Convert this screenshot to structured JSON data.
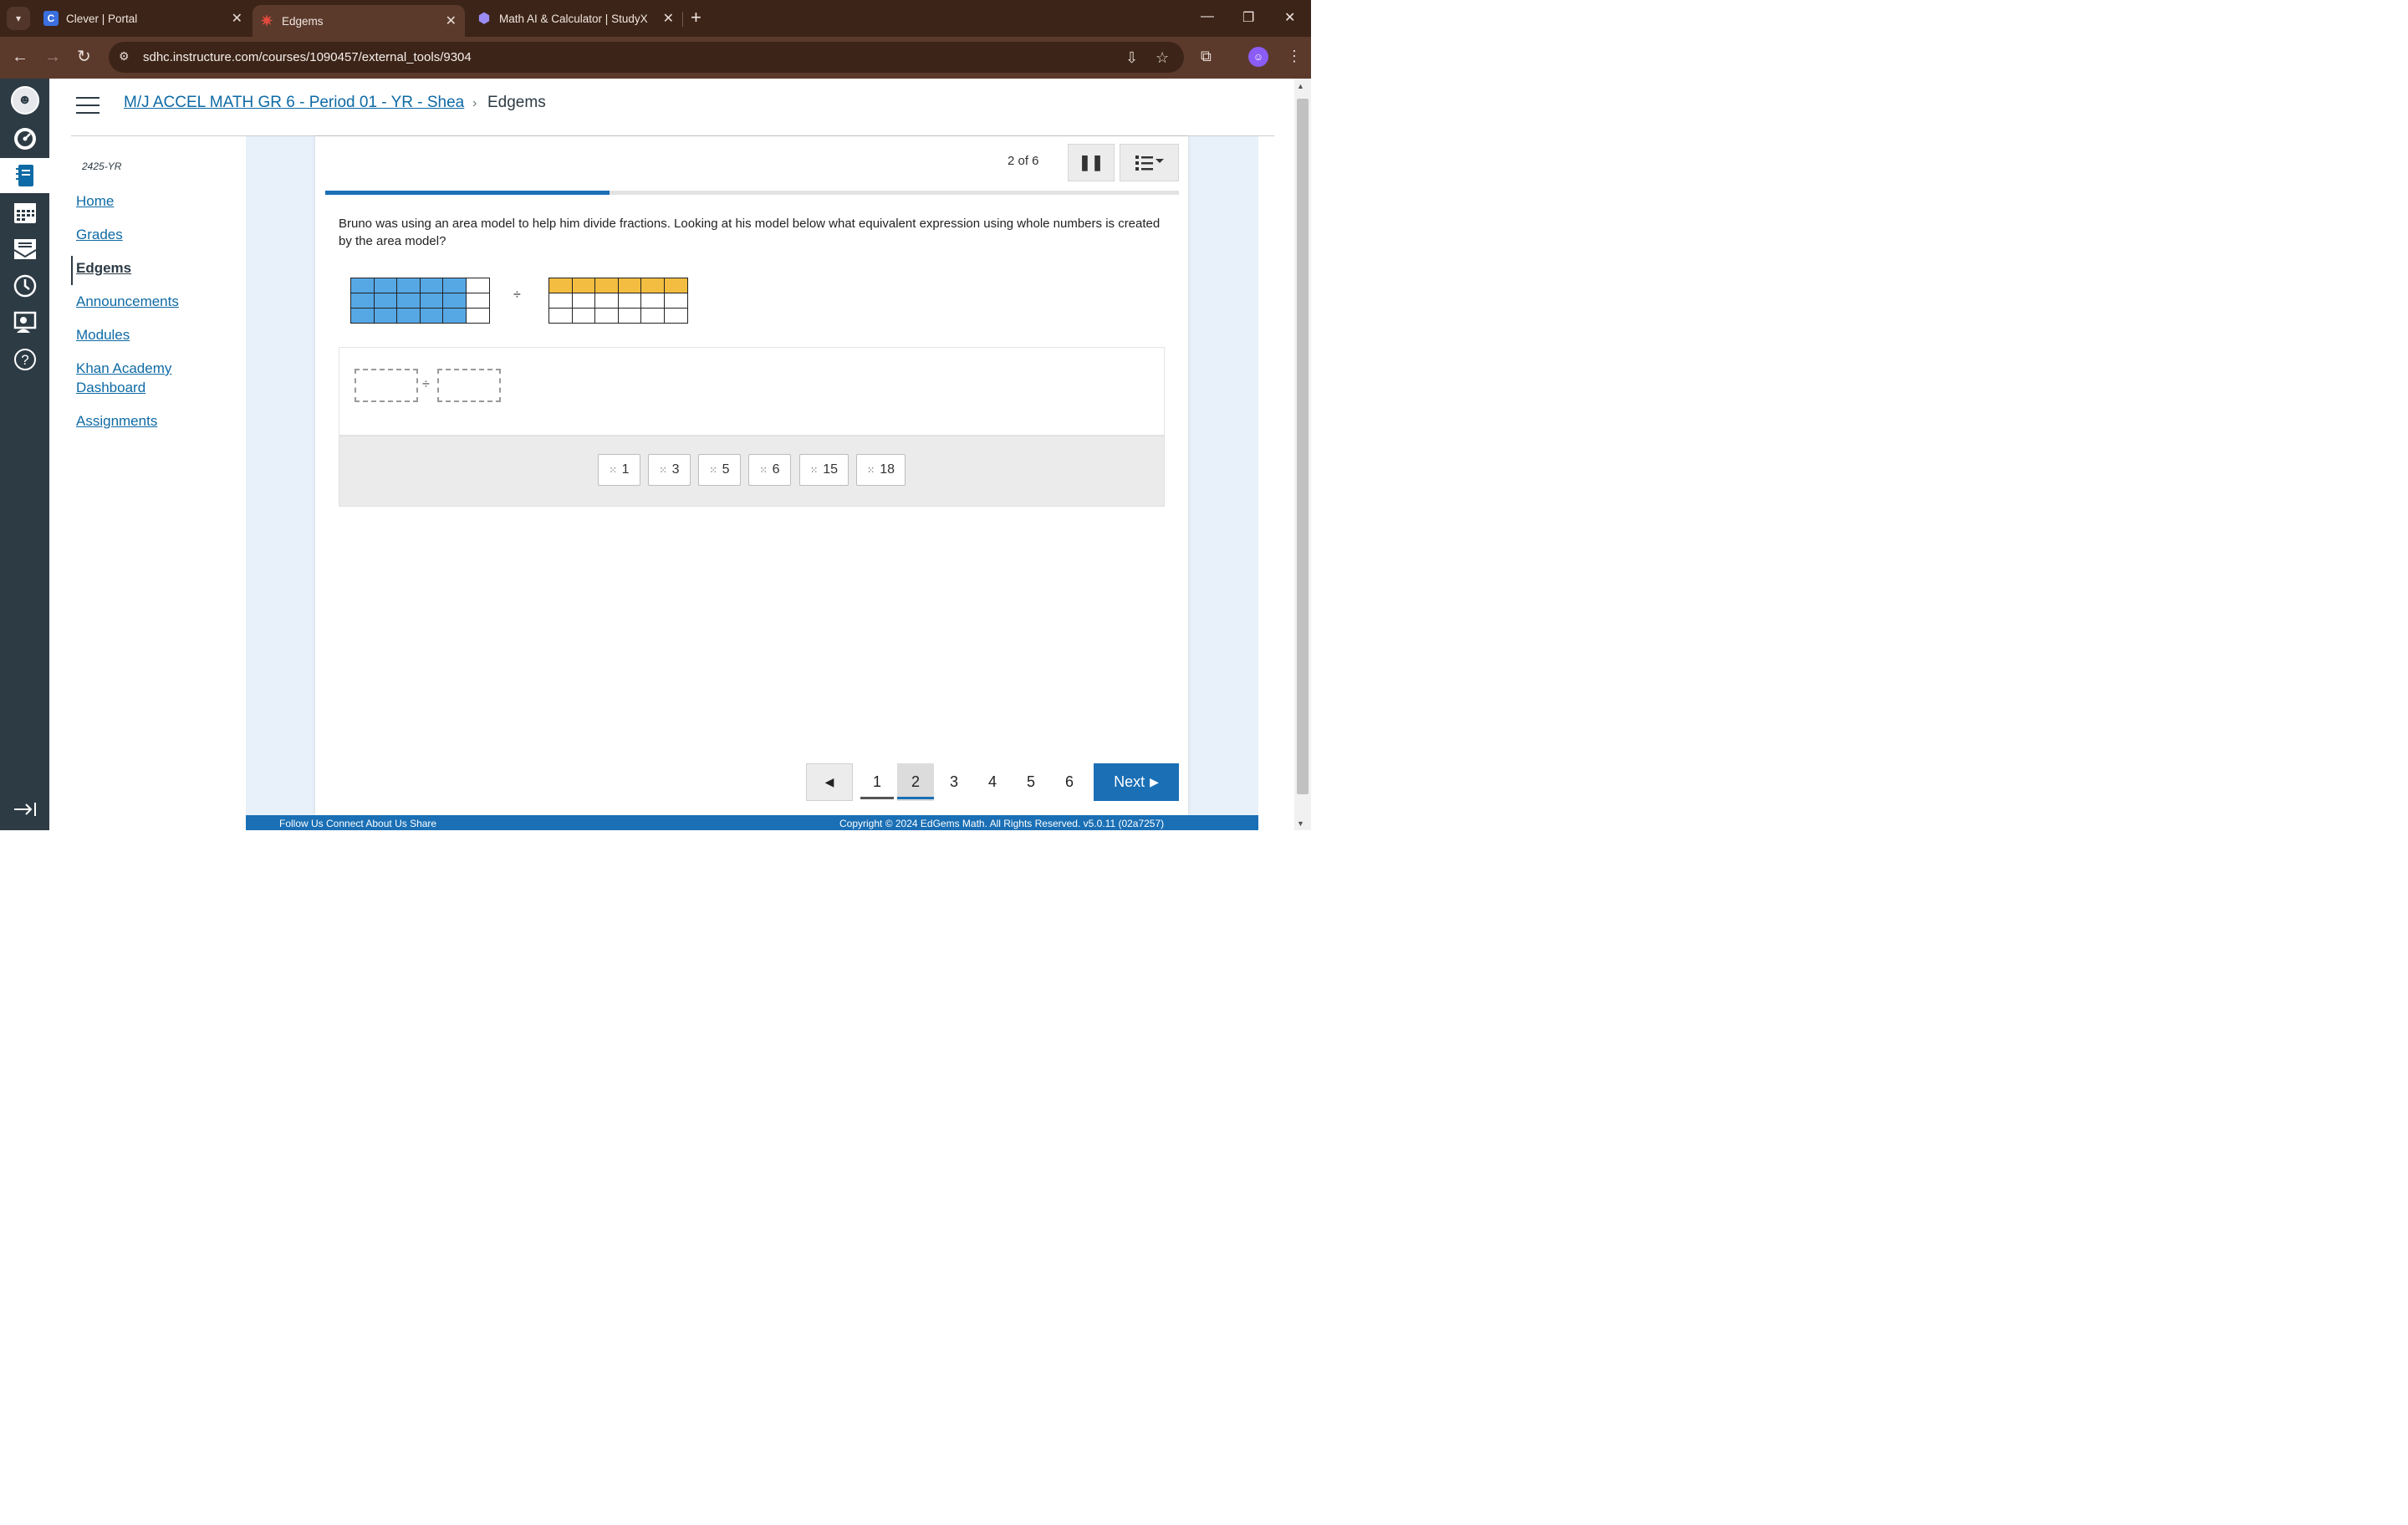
{
  "browser": {
    "tabs": [
      {
        "title": "Clever | Portal",
        "favicon": "C",
        "color": "#3b6fe0"
      },
      {
        "title": "Edgems",
        "favicon": "✷",
        "color": "#e04a3c"
      },
      {
        "title": "Math AI & Calculator | StudyX",
        "favicon": "⬢",
        "color": "#7c6cf0"
      }
    ],
    "url": "sdhc.instructure.com/courses/1090457/external_tools/9304"
  },
  "breadcrumb": {
    "course": "M/J ACCEL MATH GR 6 - Period 01 - YR - Shea",
    "current": "Edgems"
  },
  "course_nav": {
    "term": "2425-YR",
    "items": [
      {
        "label": "Home"
      },
      {
        "label": "Grades"
      },
      {
        "label": "Edgems"
      },
      {
        "label": "Announcements"
      },
      {
        "label": "Modules"
      },
      {
        "label": "Khan Academy Dashboard"
      },
      {
        "label": "Assignments"
      }
    ],
    "active_index": 2
  },
  "activity": {
    "counter": "2 of 6",
    "progress": 0.333,
    "question": "Bruno was using an area model to help him divide fractions. Looking at his model below what equivalent expression using whole numbers is created by the area model?",
    "division_symbol": "÷",
    "model_left": {
      "rows": 3,
      "cols": 6,
      "shaded_cols": 5,
      "color": "#56a8e5"
    },
    "model_right": {
      "rows": 3,
      "cols": 6,
      "shaded_rows": 1,
      "color": "#f2bd40"
    },
    "tiles": [
      "1",
      "3",
      "5",
      "6",
      "15",
      "18"
    ],
    "pages": [
      "1",
      "2",
      "3",
      "4",
      "5",
      "6"
    ],
    "current_page": 2,
    "next_label": "Next"
  },
  "footer": {
    "left": "Follow Us  Connect  About Us  Share",
    "right": "Copyright © 2024 EdGems Math. All Rights Reserved. v5.0.11 (02a7257)"
  },
  "colors": {
    "accent": "#1a6fb5",
    "canvas_nav": "#2d3b45",
    "link": "#0e6aa5"
  }
}
